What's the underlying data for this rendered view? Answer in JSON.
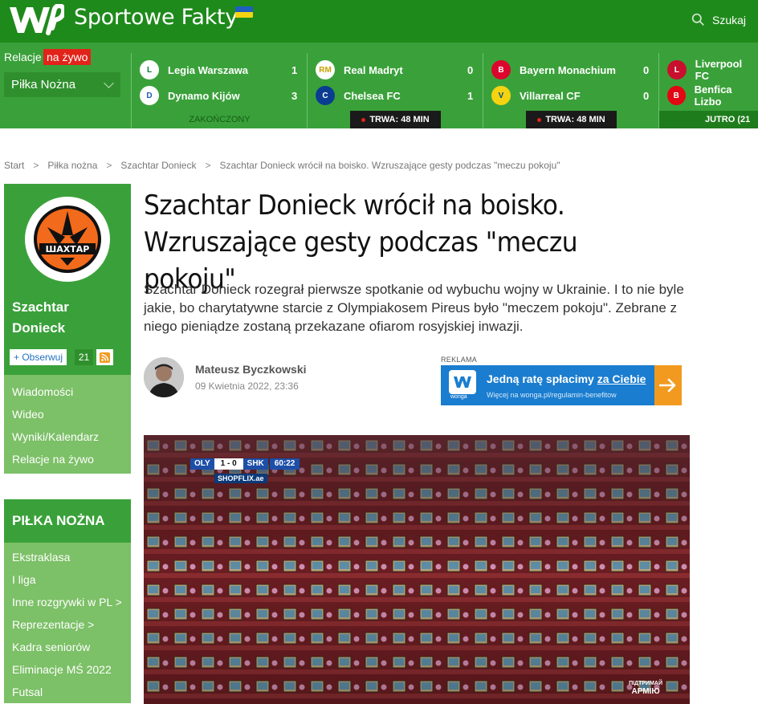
{
  "header": {
    "site_name": "Sportowe Fakty",
    "search_label": "Szukaj",
    "brand_color": "#1f8a1c"
  },
  "scores": {
    "live_label": "Relacje",
    "live_badge": "na żywo",
    "sport_select": "Piłka Nożna",
    "matches": [
      {
        "home": "Legia Warszawa",
        "home_goals": "1",
        "away": "Dynamo Kijów",
        "away_goals": "3",
        "status": "ZAKOŃCZONY"
      },
      {
        "home": "Real Madryt",
        "home_goals": "0",
        "away": "Chelsea FC",
        "away_goals": "1",
        "status": "TRWA: 48 MIN"
      },
      {
        "home": "Bayern Monachium",
        "home_goals": "0",
        "away": "Villarreal CF",
        "away_goals": "0",
        "status": "TRWA: 48 MIN"
      },
      {
        "home": "Liverpool FC",
        "home_goals": "",
        "away": "Benfica Lizbo",
        "away_goals": "",
        "status": "JUTRO (21"
      }
    ]
  },
  "breadcrumb": [
    "Start",
    "Piłka nożna",
    "Szachtar Donieck",
    "Szachtar Donieck wrócił na boisko. Wzruszające gesty podczas \"meczu pokoju\""
  ],
  "sidebar": {
    "team_name": "Szachtar Donieck",
    "team_logo_text": "ШАХТАР",
    "follow_label": "+ Obserwuj",
    "follow_count": "21",
    "team_menu": [
      "Wiadomości",
      "Wideo",
      "Wyniki/Kalendarz",
      "Relacje na żywo"
    ],
    "section_title": "PIŁKA NOŻNA",
    "section_menu": [
      "Ekstraklasa",
      "I liga",
      "Inne rozgrywki w PL >",
      "Reprezentacje >",
      "Kadra seniorów",
      "Eliminacje MŚ 2022",
      "Futsal"
    ]
  },
  "article": {
    "headline": "Szachtar Donieck wrócił na boisko. Wzruszające gesty podczas \"meczu pokoju\"",
    "lead": "Szachtar Donieck rozegrał pierwsze spotkanie od wybuchu wojny w Ukrainie. I to nie byle jakie, bo charytatywne starcie z Olympiakosem Pireus było \"meczem pokoju\". Zebrane z niego pieniądze zostaną przekazane ofiarom rosyjskiej inwazji.",
    "author": "Mateusz Byczkowski",
    "date": "09 Kwietnia 2022, 23:36"
  },
  "ad": {
    "label": "REKLAMA",
    "brand": "wonga",
    "headline_part1": "Jedną ratę spłacimy ",
    "headline_part2": "za Ciebie",
    "subtext": "Więcej na wonga.pl/regulamin-benefitow"
  },
  "photo": {
    "scorebug_home": "OLY",
    "scorebug_score": "1 - 0",
    "scorebug_away": "SHK",
    "scorebug_time": "60:22",
    "sponsor": "SHOPFLIX.ae",
    "corner_tag_1": "ПІДТРИМАЙ",
    "corner_tag_2": "АРМІЮ"
  }
}
